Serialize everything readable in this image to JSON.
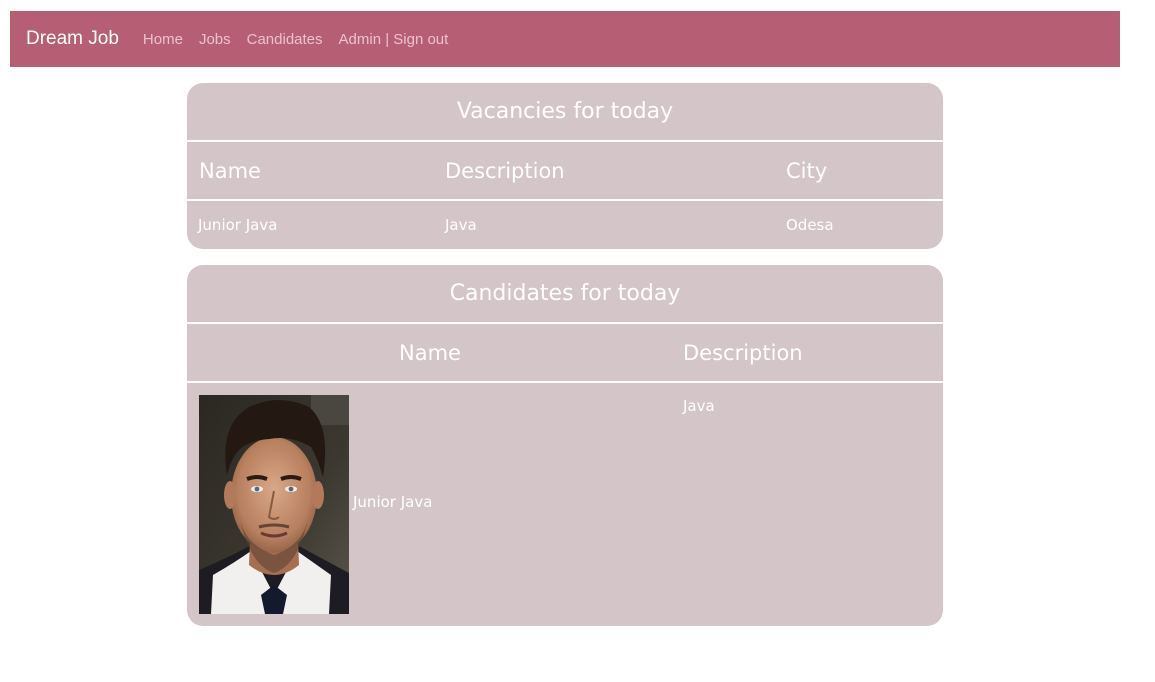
{
  "navbar": {
    "brand": "Dream Job",
    "links": [
      "Home",
      "Jobs",
      "Candidates",
      "Admin | Sign out"
    ],
    "background": "#b65e74"
  },
  "vacancies": {
    "title": "Vacancies for today",
    "columns": [
      "Name",
      "Description",
      "City"
    ],
    "rows": [
      {
        "name": "Junior Java",
        "description": "Java",
        "city": "Odesa"
      }
    ]
  },
  "candidates": {
    "title": "Candidates for today",
    "columns": [
      "Name",
      "Description"
    ],
    "rows": [
      {
        "photo": "candidate-photo",
        "name": "Junior Java",
        "description": "Java"
      }
    ]
  }
}
